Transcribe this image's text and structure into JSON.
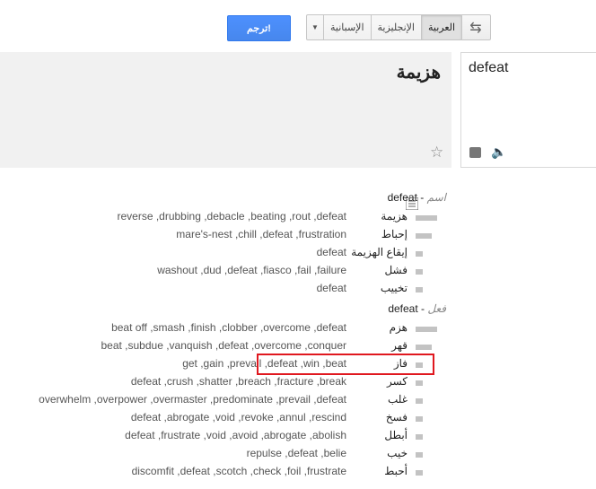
{
  "toolbar": {
    "swap_icon": "swap-arrows-icon",
    "languages": [
      "العربية",
      "الإنجليزية",
      "الإسبانية"
    ],
    "selected_language": "العربية",
    "dropdown_icon": "▼",
    "translate_label": "ترجم!",
    "translate_color": "#4d90fe"
  },
  "output": {
    "text": "هزيمة"
  },
  "input": {
    "text": "defeat"
  },
  "dictionary": {
    "noun": {
      "word": "defeat",
      "pos": "اسم",
      "entries": [
        {
          "term": "هزيمة",
          "synonyms": "reverse ,drubbing ,debacle ,beating ,rout ,defeat",
          "freq": 3
        },
        {
          "term": "إحباط",
          "synonyms": "mare's-nest ,chill ,defeat ,frustration",
          "freq": 2
        },
        {
          "term": "إيقاع الهزيمة",
          "synonyms": "defeat",
          "freq": 1
        },
        {
          "term": "فشل",
          "synonyms": "washout ,dud ,defeat ,fiasco ,fail ,failure",
          "freq": 1
        },
        {
          "term": "تخييب",
          "synonyms": "defeat",
          "freq": 1
        }
      ]
    },
    "verb": {
      "word": "defeat",
      "pos": "فعل",
      "entries": [
        {
          "term": "هزم",
          "synonyms": "beat off ,smash ,finish ,clobber ,overcome ,defeat",
          "freq": 3
        },
        {
          "term": "قهر",
          "synonyms": "beat ,subdue ,vanquish ,defeat ,overcome ,conquer",
          "freq": 2
        },
        {
          "term": "فاز",
          "synonyms": "get ,gain ,prevail ,defeat ,win ,beat",
          "freq": 1
        },
        {
          "term": "كسر",
          "synonyms": "defeat ,crush ,shatter ,breach ,fracture ,break",
          "freq": 1
        },
        {
          "term": "غلب",
          "synonyms": "overwhelm ,overpower ,overmaster ,predominate ,prevail ,defeat",
          "freq": 1
        },
        {
          "term": "فسخ",
          "synonyms": "defeat ,abrogate ,void ,revoke ,annul ,rescind",
          "freq": 1
        },
        {
          "term": "أبطل",
          "synonyms": "defeat ,frustrate ,void ,avoid ,abrogate ,abolish",
          "freq": 1
        },
        {
          "term": "خيب",
          "synonyms": "repulse ,defeat ,belie",
          "freq": 1
        },
        {
          "term": "أحبط",
          "synonyms": "discomfit ,defeat ,scotch ,check ,foil ,frustrate",
          "freq": 1
        }
      ]
    }
  },
  "highlight_color": "#e0181f"
}
